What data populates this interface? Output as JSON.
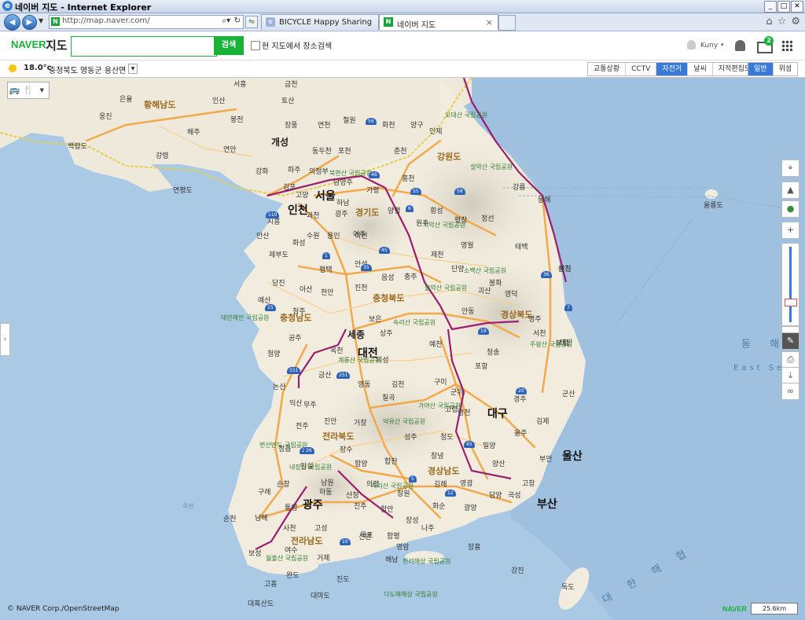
{
  "window": {
    "title": "네이버 지도 - Internet Explorer"
  },
  "browser": {
    "url": "http://map.naver.com/",
    "tabs": [
      {
        "label": "BICYCLE Happy Sharing",
        "active": false
      },
      {
        "label": "네이버 지도",
        "active": true
      }
    ]
  },
  "header": {
    "logo": "NAVER",
    "logo_suffix": "지도",
    "search_placeholder": "",
    "search_button": "검색",
    "search_in_map_label": "현 지도에서 장소검색",
    "user_name": "Kuny",
    "notification_count": "2"
  },
  "weather": {
    "temperature": "18.0°c",
    "location": "충청북도 영동군 용산면"
  },
  "layer_tabs": [
    {
      "label": "교통상황",
      "active": false
    },
    {
      "label": "CCTV",
      "active": false
    },
    {
      "label": "자전거",
      "active": true
    },
    {
      "label": "날씨",
      "active": false
    },
    {
      "label": "지적편집도",
      "active": false
    }
  ],
  "map_type_tabs": [
    {
      "label": "일반",
      "active": true
    },
    {
      "label": "위성",
      "active": false
    }
  ],
  "map": {
    "cities_major": [
      "서울",
      "인천",
      "대전",
      "대구",
      "울산",
      "부산",
      "광주",
      "개성",
      "세종"
    ],
    "provinces": [
      "황해남도",
      "강원도",
      "경기도",
      "충청남도",
      "충청북도",
      "경상북도",
      "전라북도",
      "경상남도",
      "전라남도"
    ],
    "cities_minor": [
      "서흥",
      "금천",
      "토산",
      "인산",
      "은율",
      "봉천",
      "옹진",
      "해주",
      "장풍",
      "연천",
      "철원",
      "화천",
      "양구",
      "인제",
      "강령",
      "백령도",
      "연안",
      "동두천",
      "포천",
      "춘천",
      "파주",
      "의정부",
      "남양주",
      "가평",
      "홍천",
      "강화",
      "김포",
      "고양",
      "하남",
      "양평",
      "횡성",
      "연평도",
      "시흥",
      "과천",
      "광주",
      "여주",
      "평창",
      "정선",
      "강릉",
      "동해",
      "울릉도",
      "안산",
      "화성",
      "수원",
      "용인",
      "이천",
      "원주",
      "영월",
      "태백",
      "삼척",
      "제부도",
      "평택",
      "안성",
      "음성",
      "제천",
      "단양",
      "봉화",
      "울진",
      "당진",
      "아산",
      "천안",
      "진천",
      "충주",
      "괴산",
      "영주",
      "태안",
      "예산",
      "청주",
      "보은",
      "상주",
      "예천",
      "안동",
      "영덕",
      "보령",
      "청양",
      "공주",
      "옥천",
      "의성",
      "청송",
      "서천",
      "논산",
      "금산",
      "영동",
      "김천",
      "구미",
      "군위",
      "포항",
      "군산",
      "익산",
      "무주",
      "칠곡",
      "영천",
      "경주",
      "김제",
      "전주",
      "진안",
      "거창",
      "성주",
      "고령",
      "청도",
      "울주",
      "부안",
      "정읍",
      "임실",
      "장수",
      "함양",
      "합천",
      "창녕",
      "밀양",
      "양산",
      "고창",
      "순창",
      "남원",
      "산청",
      "의령",
      "창원",
      "김해",
      "영광",
      "담양",
      "곡성",
      "구례",
      "하동",
      "진주",
      "함안",
      "장성",
      "화순",
      "광양",
      "사천",
      "고성",
      "신안",
      "함평",
      "나주",
      "순천",
      "남해",
      "통영",
      "목포",
      "영암",
      "장흥",
      "보성",
      "여수",
      "거제",
      "해남",
      "강진",
      "고흥",
      "완도",
      "진도",
      "대마도",
      "대흑산도",
      "독도",
      "죽변"
    ],
    "parks": [
      "오대산 국립공원",
      "설악산 국립공원",
      "북한산 국립공원",
      "치악산 국립공원",
      "소백산 국립공원",
      "월악산 국립공원",
      "속리산 국립공원",
      "주왕산 국립공원",
      "계룡산 국립공원",
      "덕유산 국립공원",
      "가야산 국립공원",
      "변산반도 국립공원",
      "내장산 국립공원",
      "지리산 국립공원",
      "월출산 국립공원",
      "한려해상 국립공원",
      "다도해해상 국립공원",
      "태안해안 국립공원"
    ],
    "route_numbers": [
      "56",
      "46",
      "55",
      "58",
      "110",
      "7",
      "6",
      "1",
      "35",
      "45",
      "36",
      "15",
      "25",
      "151",
      "251",
      "20",
      "19",
      "12",
      "10",
      "45",
      "5",
      "26"
    ],
    "sea_labels": [
      "동 해",
      "East Sea",
      "대 한 해 협"
    ],
    "copyright": "© NAVER Corp./OpenStreetMap",
    "scale_label": "25.6km",
    "brand": "NAVER"
  }
}
